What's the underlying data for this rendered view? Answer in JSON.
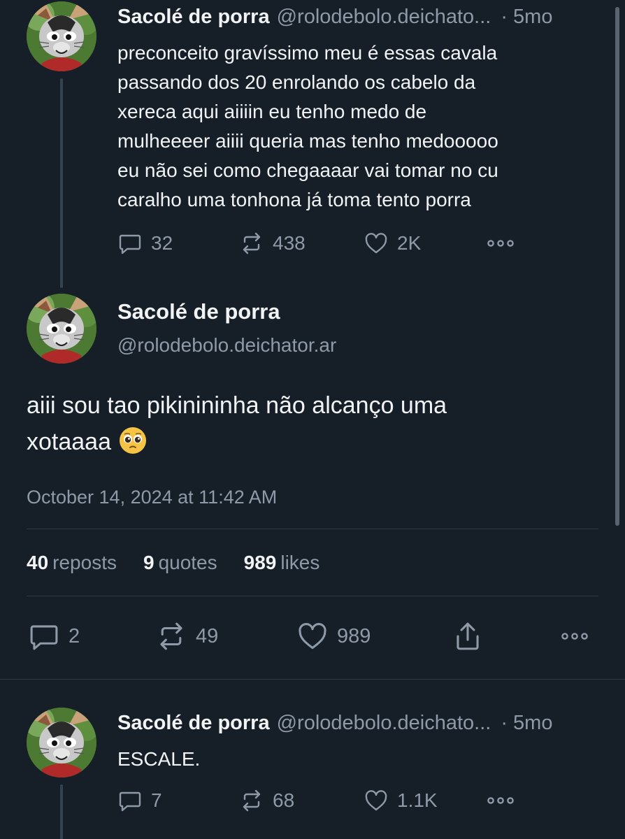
{
  "parent_post": {
    "author_name": "Sacolé de porra",
    "author_handle": "@rolodebolo.deichato...",
    "separator": "·",
    "time_ago": "5mo",
    "text": "preconceito gravíssimo meu é essas cavala\npassando dos 20 enrolando os cabelo da\nxereca aqui aiiiin eu tenho medo de\nmulheeeer aiiii queria mas tenho medooooo\neu não sei como chegaaaar vai tomar no cu\ncaralho uma tonhona já toma tento porra",
    "replies": "32",
    "reposts": "438",
    "likes": "2K"
  },
  "main_post": {
    "author_name": "Sacolé de porra",
    "author_handle": "@rolodebolo.deichator.ar",
    "text": "aiii sou tao pikinininha não alcanço uma\nxotaaaa",
    "date": "October 14, 2024 at 11:42 AM",
    "stats": {
      "reposts_count": "40",
      "reposts_label": "reposts",
      "quotes_count": "9",
      "quotes_label": "quotes",
      "likes_count": "989",
      "likes_label": "likes"
    },
    "actions": {
      "replies": "2",
      "reposts": "49",
      "likes": "989"
    }
  },
  "reply_post": {
    "author_name": "Sacolé de porra",
    "author_handle": "@rolodebolo.deichato...",
    "separator": "·",
    "time_ago": "5mo",
    "text": "ESCALE.",
    "replies": "7",
    "reposts": "68",
    "likes": "1.1K"
  },
  "icons": {
    "reply": "speech-bubble-icon",
    "repost": "repost-arrows-icon",
    "like": "heart-icon",
    "share": "share-upload-icon",
    "more": "more-dots-icon",
    "emoji": "pleading-face-emoji"
  },
  "colors": {
    "background": "#161e27",
    "text_primary": "#f1f3f5",
    "text_secondary": "#8f9aa8",
    "thread_line": "#34414f",
    "divider": "#2c3744"
  }
}
